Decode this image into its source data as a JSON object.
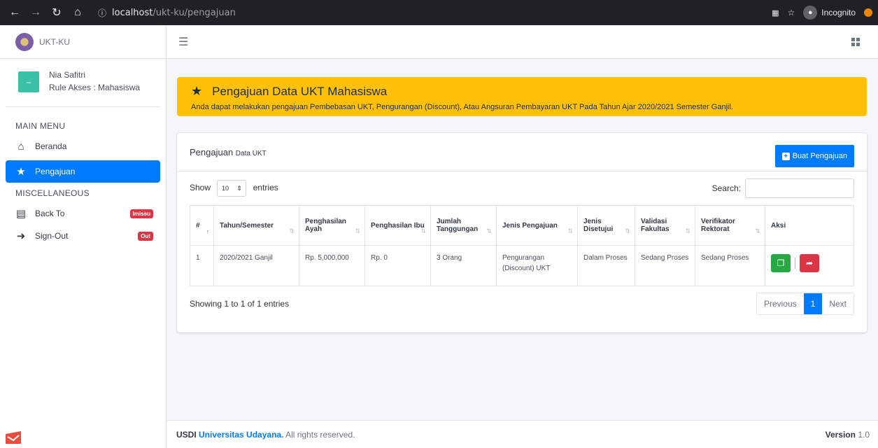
{
  "browser": {
    "url_host": "localhost",
    "url_path": "/ukt-ku/pengajuan",
    "incognito_label": "Incognito"
  },
  "sidebar": {
    "brand": "UKT-KU",
    "user_name": "Nia Safitri",
    "user_role": "Rule Akses : Mahasiswa",
    "main_menu_header": "MAIN MENU",
    "misc_header": "MISCELLANEOUS",
    "items": [
      {
        "label": "Beranda",
        "icon": "home-icon"
      },
      {
        "label": "Pengajuan",
        "icon": "star-icon"
      },
      {
        "label": "Back To",
        "icon": "inbox-icon",
        "badge": "Imissu"
      },
      {
        "label": "Sign-Out",
        "icon": "sign-out-icon",
        "badge": "Out"
      }
    ]
  },
  "alert": {
    "title": "Pengajuan Data UKT Mahasiswa",
    "description": "Anda dapat melakukan pengajuan Pembebasan UKT, Pengurangan (Discount), Atau Angsuran Pembayaran UKT Pada Tahun Ajar 2020/2021 Semester Ganjil."
  },
  "card": {
    "title": "Pengajuan",
    "title_small": "Data UKT",
    "button_label": "Buat Pengajuan"
  },
  "datatable": {
    "show_label": "Show",
    "entries_value": "10",
    "entries_label": "entries",
    "search_label": "Search:",
    "columns": [
      "#",
      "Tahun/Semester",
      "Penghasilan Ayah",
      "Penghasilan Ibu",
      "Jumlah Tanggungan",
      "Jenis Pengajuan",
      "Jenis Disetujui",
      "Validasi Fakultas",
      "Verifikator Rektorat",
      "Aksi"
    ],
    "rows": [
      [
        "1",
        "2020/2021 Ganjil",
        "Rp. 5,000,000",
        "Rp. 0",
        "3 Orang",
        "Pengurangan (Discount) UKT",
        "Dalam Proses",
        "Sedang Proses",
        "Sedang Proses"
      ]
    ],
    "info": "Showing 1 to 1 of 1 entries",
    "pagination": {
      "previous": "Previous",
      "current": "1",
      "next": "Next"
    }
  },
  "footer": {
    "org_prefix": "USDI",
    "org_name": "Universitas Udayana.",
    "rights": "All rights reserved.",
    "version_label": "Version",
    "version": "1.0"
  }
}
